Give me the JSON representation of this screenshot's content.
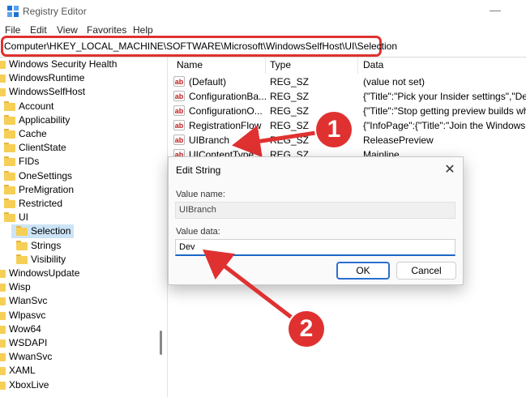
{
  "window": {
    "title": "Registry Editor",
    "minimize_glyph": "—"
  },
  "menu": [
    "File",
    "Edit",
    "View",
    "Favorites",
    "Help"
  ],
  "address": "Computer\\HKEY_LOCAL_MACHINE\\SOFTWARE\\Microsoft\\WindowsSelfHost\\UI\\Selection",
  "tree": [
    {
      "label": "Windows Security Health",
      "icon": "folder-icon"
    },
    {
      "label": "WindowsRuntime",
      "icon": "folder-icon"
    },
    {
      "label": "WindowsSelfHost",
      "icon": "folder-icon"
    },
    {
      "label": "Account",
      "icon": "folder-icon"
    },
    {
      "label": "Applicability",
      "icon": "folder-icon"
    },
    {
      "label": "Cache",
      "icon": "folder-icon"
    },
    {
      "label": "ClientState",
      "icon": "folder-icon"
    },
    {
      "label": "FIDs",
      "icon": "folder-icon"
    },
    {
      "label": "OneSettings",
      "icon": "folder-icon"
    },
    {
      "label": "PreMigration",
      "icon": "folder-icon"
    },
    {
      "label": "Restricted",
      "icon": "folder-icon"
    },
    {
      "label": "UI",
      "icon": "folder-icon"
    },
    {
      "label": "Selection",
      "icon": "folder-icon"
    },
    {
      "label": "Strings",
      "icon": "folder-icon"
    },
    {
      "label": "Visibility",
      "icon": "folder-icon"
    },
    {
      "label": "WindowsUpdate",
      "icon": "folder-icon"
    },
    {
      "label": "Wisp",
      "icon": "folder-icon"
    },
    {
      "label": "WlanSvc",
      "icon": "folder-icon"
    },
    {
      "label": "Wlpasvc",
      "icon": "folder-icon"
    },
    {
      "label": "Wow64",
      "icon": "folder-icon"
    },
    {
      "label": "WSDAPI",
      "icon": "folder-icon"
    },
    {
      "label": "WwanSvc",
      "icon": "folder-icon"
    },
    {
      "label": "XAML",
      "icon": "folder-icon"
    },
    {
      "label": "XboxLive",
      "icon": "folder-icon"
    }
  ],
  "columns": {
    "name": "Name",
    "type": "Type",
    "data": "Data"
  },
  "values": [
    {
      "icon": "ab",
      "name": "(Default)",
      "type": "REG_SZ",
      "data": "(value not set)"
    },
    {
      "icon": "ab",
      "name": "ConfigurationBa...",
      "type": "REG_SZ",
      "data": "{\"Title\":\"Pick your Insider settings\",\"Desc"
    },
    {
      "icon": "ab",
      "name": "ConfigurationO...",
      "type": "REG_SZ",
      "data": "{\"Title\":\"Stop getting preview builds whe"
    },
    {
      "icon": "ab",
      "name": "RegistrationFlow",
      "type": "REG_SZ",
      "data": "{\"InfoPage\":{\"Title\":\"Join the Windows In"
    },
    {
      "icon": "ab",
      "name": "UIBranch",
      "type": "REG_SZ",
      "data": "ReleasePreview"
    },
    {
      "icon": "ab",
      "name": "UIContentType",
      "type": "REG_SZ",
      "data": "Mainline"
    }
  ],
  "dialog": {
    "title": "Edit String",
    "close_glyph": "✕",
    "value_name_label": "Value name:",
    "value_name": "UIBranch",
    "value_data_label": "Value data:",
    "value_data": "Dev",
    "ok": "OK",
    "cancel": "Cancel"
  },
  "annotations": {
    "badge1": "1",
    "badge2": "2",
    "color": "#e03131"
  }
}
